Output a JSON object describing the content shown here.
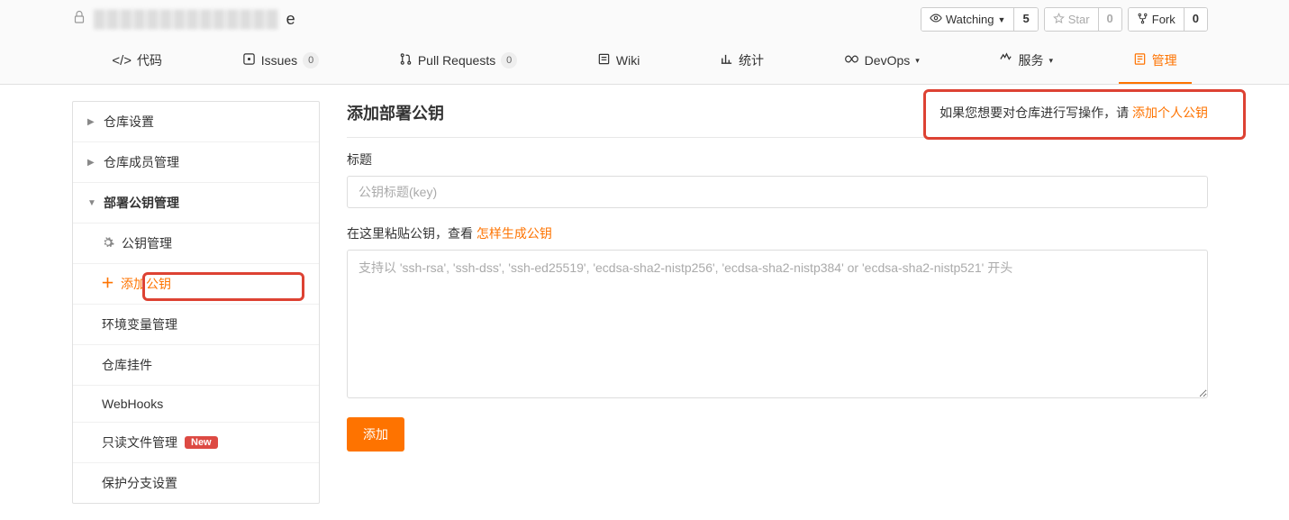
{
  "repo": {
    "name_suffix": "e"
  },
  "actions": {
    "watch": {
      "label": "Watching",
      "count": "5"
    },
    "star": {
      "label": "Star",
      "count": "0"
    },
    "fork": {
      "label": "Fork",
      "count": "0"
    }
  },
  "tabs": {
    "code": "代码",
    "issues": {
      "label": "Issues",
      "count": "0"
    },
    "pr": {
      "label": "Pull Requests",
      "count": "0"
    },
    "wiki": "Wiki",
    "stats": "统计",
    "devops": "DevOps",
    "services": "服务",
    "manage": "管理"
  },
  "sidebar": {
    "repo_settings": "仓库设置",
    "member_mgmt": "仓库成员管理",
    "deploy_key_mgmt": "部署公钥管理",
    "key_mgmt": "公钥管理",
    "add_key": "添加公钥",
    "env_var": "环境变量管理",
    "plugins": "仓库挂件",
    "webhooks": "WebHooks",
    "readonly": "只读文件管理",
    "readonly_badge": "New",
    "branch_protect": "保护分支设置"
  },
  "main": {
    "title": "添加部署公钥",
    "hint_prefix": "如果您想要对仓库进行写操作，请 ",
    "hint_link": "添加个人公钥",
    "title_label": "标题",
    "title_placeholder": "公钥标题(key)",
    "key_label_prefix": "在这里粘贴公钥，查看 ",
    "key_label_link": "怎样生成公钥",
    "key_placeholder": "支持以 'ssh-rsa', 'ssh-dss', 'ssh-ed25519', 'ecdsa-sha2-nistp256', 'ecdsa-sha2-nistp384' or 'ecdsa-sha2-nistp521' 开头",
    "submit": "添加"
  }
}
